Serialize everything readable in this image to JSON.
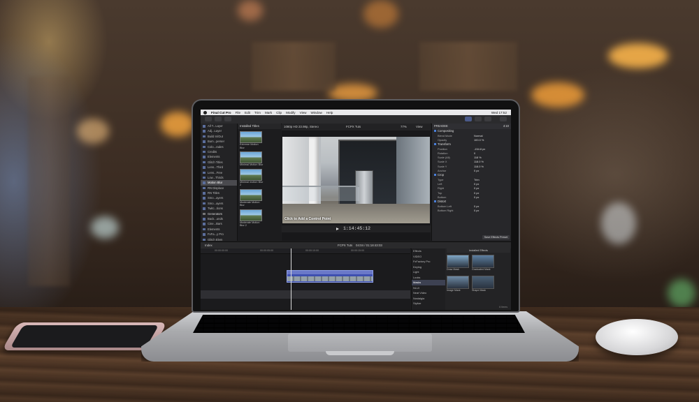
{
  "scene": {
    "description_colors": {
      "bokeh_warm": "#f6b44a",
      "wood": "#5b3f2b",
      "laptop_bezel": "#111111"
    }
  },
  "screen": {
    "menubar": {
      "app": "Final Cut Pro",
      "items": [
        "File",
        "Edit",
        "Trim",
        "Mark",
        "Clip",
        "Modify",
        "View",
        "Window",
        "Help"
      ],
      "clock": "Wed 17:52"
    },
    "browser": {
      "items": [
        {
          "label": "All T...Layer",
          "selected": false,
          "category": false
        },
        {
          "label": "Adj...Layer",
          "selected": false,
          "category": false
        },
        {
          "label": "Build In/Out",
          "selected": false,
          "category": false
        },
        {
          "label": "Bum...perser",
          "selected": false,
          "category": false
        },
        {
          "label": "Colo...rades",
          "selected": false,
          "category": false
        },
        {
          "label": "Credits",
          "selected": false,
          "category": false
        },
        {
          "label": "Elements",
          "selected": false,
          "category": false
        },
        {
          "label": "Glitch Titles",
          "selected": false,
          "category": false
        },
        {
          "label": "Lens...Third",
          "selected": false,
          "category": false
        },
        {
          "label": "Lens...Free",
          "selected": false,
          "category": false
        },
        {
          "label": "Low...Thirds",
          "selected": false,
          "category": false
        },
        {
          "label": "Motion Blur",
          "selected": true,
          "category": false
        },
        {
          "label": "RN Displace",
          "selected": false,
          "category": false
        },
        {
          "label": "RN Titles",
          "selected": false,
          "category": false
        },
        {
          "label": "Smo...ayers",
          "selected": false,
          "category": false
        },
        {
          "label": "Smo...ayers",
          "selected": false,
          "category": false
        },
        {
          "label": "Twitc...tions",
          "selected": false,
          "category": false
        },
        {
          "label": "Generators",
          "selected": false,
          "category": true
        },
        {
          "label": "Back...unds",
          "selected": false,
          "category": false
        },
        {
          "label": "Cine...Bars",
          "selected": false,
          "category": false
        },
        {
          "label": "Elements",
          "selected": false,
          "category": false
        },
        {
          "label": "FxFa...y Pro",
          "selected": false,
          "category": false
        },
        {
          "label": "Glitch Elem",
          "selected": false,
          "category": false
        }
      ]
    },
    "library": {
      "header": "Installed Titles",
      "thumbs": [
        "Extreme Motion Blur",
        "Minimal Motion Blur",
        "Minimal motion Blur 2",
        "Moderate Motion Blur",
        "Moderate Motion Blur 2"
      ]
    },
    "viewer": {
      "format": "1080p HD 23.98p, Stereo",
      "clip_name": "FCPX Tuts",
      "zoom": "77%",
      "view_label": "View",
      "caption": "Click to Add a Control Point",
      "timecode": "1:14:45:12"
    },
    "inspector": {
      "header": "FREADEE",
      "duration": "4:10",
      "sections": [
        {
          "title": "Compositing",
          "rows": [
            {
              "k": "Blend Mode",
              "v": "Normal"
            },
            {
              "k": "Opacity",
              "v": "100.0 %"
            }
          ]
        },
        {
          "title": "Transform",
          "rows": [
            {
              "k": "Position",
              "v": "-154.8 px"
            },
            {
              "k": "Rotation",
              "v": "0"
            },
            {
              "k": "Scale (All)",
              "v": "118 %"
            },
            {
              "k": "Scale X",
              "v": "118.0 %"
            },
            {
              "k": "Scale Y",
              "v": "118.0 %"
            },
            {
              "k": "Anchor",
              "v": "0 px"
            }
          ]
        },
        {
          "title": "Crop",
          "rows": [
            {
              "k": "Type",
              "v": "Trim"
            },
            {
              "k": "Left",
              "v": "0 px"
            },
            {
              "k": "Right",
              "v": "0 px"
            },
            {
              "k": "Top",
              "v": "0 px"
            },
            {
              "k": "Bottom",
              "v": "0 px"
            }
          ]
        },
        {
          "title": "Distort",
          "rows": [
            {
              "k": "Bottom Left",
              "v": "0 px"
            },
            {
              "k": "Bottom Right",
              "v": "0 px"
            }
          ]
        }
      ],
      "save_label": "Save Effects Preset"
    },
    "timeline_bar": {
      "index_label": "Index",
      "project": "FCPX Tuts",
      "position": "04:04 / 01:18:43:03"
    },
    "effects": {
      "categories": [
        "Effects",
        "VIDEO",
        "FxFactory Pro",
        "Keying",
        "Light",
        "Looks",
        "Masks",
        "NLUI",
        "Neat Video",
        "Nostalgia",
        "Stylize"
      ],
      "selected_category": "Masks",
      "header": "Installed Effects",
      "items": [
        {
          "label": "Draw Mask",
          "color": "#7fa6c6"
        },
        {
          "label": "Graduated Mask",
          "color": "#5c7fa0"
        },
        {
          "label": "Image Mask",
          "color": "#6e8aa4"
        },
        {
          "label": "Shape Mask",
          "color": "#4a5f74"
        }
      ],
      "footer": "6 Items"
    }
  }
}
